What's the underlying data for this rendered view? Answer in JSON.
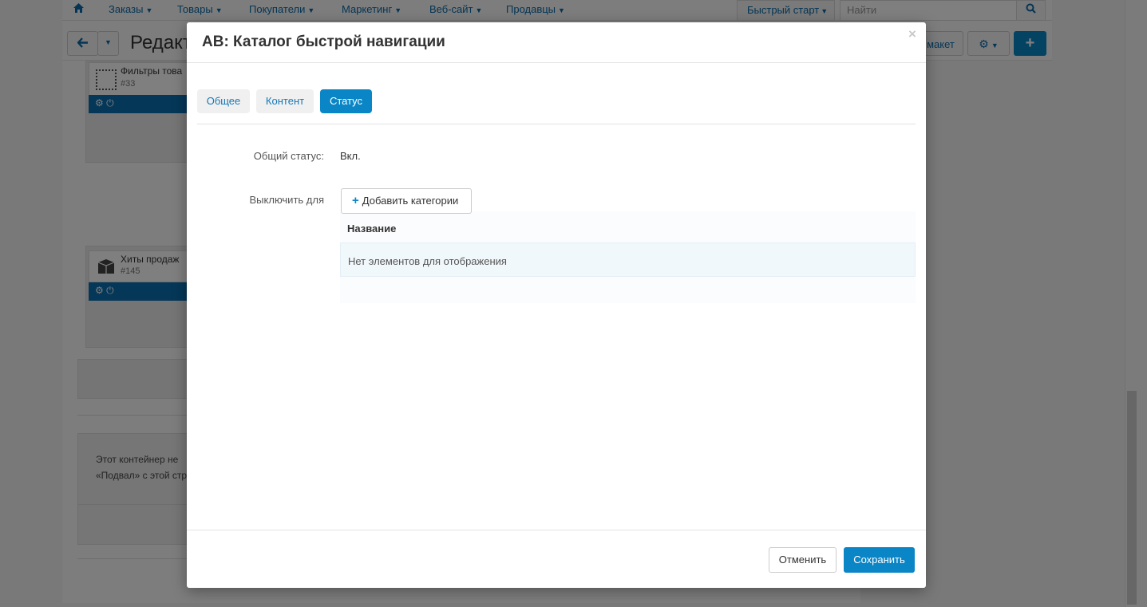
{
  "nav": {
    "home_icon": "home-icon",
    "items": [
      {
        "label": "Заказы"
      },
      {
        "label": "Товары"
      },
      {
        "label": "Покупатели"
      },
      {
        "label": "Маркетинг"
      },
      {
        "label": "Веб-сайт"
      },
      {
        "label": "Продавцы"
      }
    ],
    "quick_start": "Быстрый старт",
    "search_placeholder": "Найти"
  },
  "toolbar": {
    "page_title": "Редакт",
    "layout_button": "макет"
  },
  "background": {
    "widget1": {
      "name": "Фильтры това",
      "id": "#33"
    },
    "widget2": {
      "name": "Хиты продаж",
      "id": "#145"
    },
    "note_line1": "Этот контейнер не",
    "note_line2": "«Подвал» с этой стр"
  },
  "modal": {
    "title": "AB: Каталог быстрой навигации",
    "close_label": "×",
    "tabs": [
      {
        "label": "Общее",
        "active": false
      },
      {
        "label": "Контент",
        "active": false
      },
      {
        "label": "Статус",
        "active": true
      }
    ],
    "status_label": "Общий статус:",
    "status_value": "Вкл.",
    "disable_for_label": "Выключить для",
    "add_categories_button": "Добавить категории",
    "table": {
      "column_header": "Название",
      "empty_text": "Нет элементов для отображения"
    },
    "cancel_button": "Отменить",
    "save_button": "Сохранить"
  },
  "colors": {
    "accent": "#0a86c7",
    "link": "#1778b5",
    "overlay": "rgba(0,0,0,0.5)"
  }
}
